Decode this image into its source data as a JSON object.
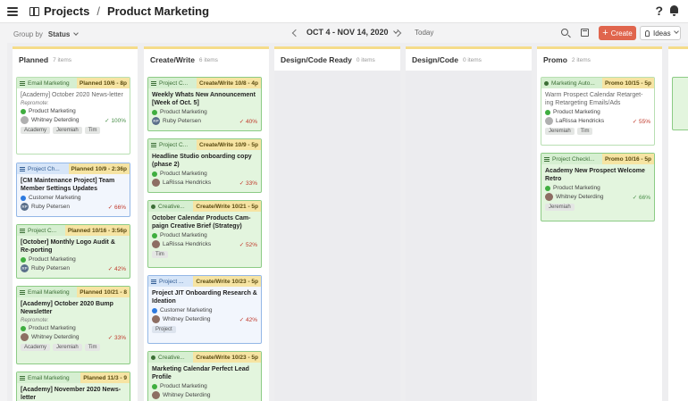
{
  "header": {
    "section": "Projects",
    "page": "Product Marketing",
    "help": "?"
  },
  "toolbar": {
    "group_by_label": "Group by",
    "group_by_value": "Status",
    "date_range": "OCT 4 - NOV 14, 2020",
    "today": "Today",
    "create": "Create",
    "ideas": "Ideas"
  },
  "columns": [
    {
      "title": "Planned",
      "count": "7 items",
      "cards": [
        {
          "tag": "Email Marketing",
          "status": "Planned 10/6 - 8p",
          "title": "[Academy] October 2020 News-letter",
          "repro": "Repromote:",
          "team": "Product Marketing",
          "owner": "Whitney Deterding",
          "pct": "100%",
          "chips": [
            "Academy",
            "Jeremiah",
            "Tim"
          ]
        },
        {
          "tag": "Project Ch...",
          "status": "Planned 10/9 - 2:36p",
          "title": "[CM Maintenance Project] Team Member Settings Updates",
          "team": "Customer Marketing",
          "owner": "Ruby Petersen",
          "pct": "66%"
        },
        {
          "tag": "Project C...",
          "status": "Planned 10/16 - 3:56p",
          "title": "[October] Monthly Logo Audit & Re-porting",
          "team": "Product Marketing",
          "owner": "Ruby Petersen",
          "pct": "42%"
        },
        {
          "tag": "Email Marketing",
          "status": "Planned 10/21 - 8",
          "title": "[Academy] October 2020 Bump Newsletter",
          "repro": "Repromote:",
          "team": "Product Marketing",
          "owner": "Whitney Deterding",
          "pct": "33%",
          "chips": [
            "Academy",
            "Jeremiah",
            "Tim"
          ]
        },
        {
          "tag": "Email Marketing",
          "status": "Planned 11/3 - 9",
          "title": "[Academy] November 2020 News-letter"
        }
      ]
    },
    {
      "title": "Create/Write",
      "count": "6 items",
      "cards": [
        {
          "tag": "Project C...",
          "status": "Create/Write 10/8 - 4p",
          "title": "Weekly Whats New Announcement [Week of Oct. 5]",
          "team": "Product Marketing",
          "owner": "Ruby Petersen",
          "pct": "40%"
        },
        {
          "tag": "Project C...",
          "status": "Create/Write 10/9 - 5p",
          "title": "Headline Studio onboarding copy (phase 2)",
          "team": "Product Marketing",
          "owner": "LaRissa Hendricks",
          "pct": "33%"
        },
        {
          "tag": "Creative...",
          "status": "Create/Write 10/21 - 5p",
          "title": "October Calendar Products Cam-paign Creative Brief (Strategy)",
          "team": "Product Marketing",
          "owner": "LaRissa Hendricks",
          "pct": "52%",
          "chips": [
            "Tim"
          ]
        },
        {
          "tag": "Project ...",
          "status": "Create/Write 10/23 - 5p",
          "title": "Project JIT Onboarding Research & Ideation",
          "team": "Customer Marketing",
          "owner": "Whitney Deterding",
          "pct": "42%",
          "chips": [
            "Project"
          ]
        },
        {
          "tag": "Creative...",
          "status": "Create/Write 10/23 - 5p",
          "title": "Marketing Calendar Perfect Lead Profile",
          "team": "Product Marketing",
          "owner": "Whitney Deterding"
        }
      ]
    },
    {
      "title": "Design/Code Ready",
      "count": "0 items"
    },
    {
      "title": "Design/Code",
      "count": "0 items"
    },
    {
      "title": "Promo",
      "count": "2 items",
      "cards": [
        {
          "tag": "Marketing Auto...",
          "status": "Promo 10/15 - 5p",
          "title": "Warm Prospect Calendar Retarget-ing Retargeting Emails/Ads",
          "team": "Product Marketing",
          "owner": "LaRissa Hendricks",
          "pct": "55%",
          "chips": [
            "Jeremiah",
            "Tim"
          ]
        },
        {
          "tag": "Project Checkl...",
          "status": "Promo 10/16 - 5p",
          "title": "Academy New Prospect Welcome Retro",
          "team": "Product Marketing",
          "owner": "Whitney Deterding",
          "pct": "66%",
          "chips": [
            "Jeremiah"
          ]
        }
      ]
    }
  ],
  "colors": {
    "create": "#e0654d",
    "column_accent": "#f5dc8a",
    "card_green": "#9ed39a",
    "card_blue": "#93b7e6"
  },
  "icons": [
    "menu-icon",
    "projects-icon",
    "help-icon",
    "bell-icon",
    "search-icon",
    "calendar-icon",
    "lightbulb-icon"
  ]
}
